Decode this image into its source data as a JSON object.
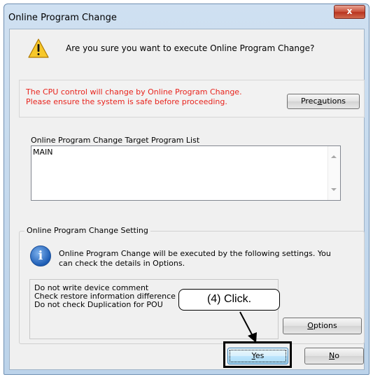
{
  "window": {
    "title": "Online Program Change",
    "close_label": "x"
  },
  "dialog": {
    "question": "Are you sure you want to execute Online Program Change?",
    "warning_line1": "The CPU control will change by Online Program Change.",
    "warning_line2": "Please ensure the system is safe before proceeding.",
    "precautions_pre": "Prec",
    "precautions_mnemonic": "a",
    "precautions_post": "utions",
    "target_list_label": "Online Program Change Target Program List",
    "target_list_items": [
      "MAIN"
    ],
    "setting_group_title": "Online Program Change Setting",
    "info_line1": "Online Program Change will be executed by the following settings. You",
    "info_line2": "can check the details in Options.",
    "settings_lines": [
      "Do not write device comment",
      "Check restore information difference",
      "Do not check Duplication for POU"
    ],
    "options_mnemonic": "O",
    "options_post": "ptions",
    "yes_mnemonic": "Y",
    "yes_post": "es",
    "no_mnemonic": "N",
    "no_post": "o"
  },
  "annotation": {
    "callout_text": "(4) Click."
  },
  "colors": {
    "warning_text": "#e8231c",
    "title_bar": "#cfe0f1",
    "close_button": "#c9503a"
  }
}
